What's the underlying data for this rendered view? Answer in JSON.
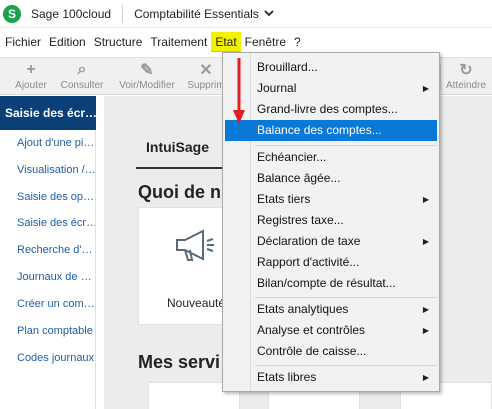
{
  "titlebar": {
    "app_name": "Sage 100cloud",
    "module": "Comptabilité Essentials",
    "logo_icon": "sage-logo-icon",
    "logo_glyph": "S"
  },
  "menubar": {
    "items": [
      "Fichier",
      "Edition",
      "Structure",
      "Traitement",
      "Etat",
      "Fenêtre",
      "?"
    ],
    "active": "Etat",
    "active_color": "#f2f200"
  },
  "toolbar": {
    "buttons": [
      {
        "label": "Ajouter",
        "icon": "plus-icon",
        "glyph": "+"
      },
      {
        "label": "Consulter",
        "icon": "search-icon",
        "glyph": "⌕"
      },
      {
        "label": "Voir/Modifier",
        "icon": "pencil-icon",
        "glyph": "✎"
      },
      {
        "label": "Supprim",
        "icon": "delete-icon",
        "glyph": "✕"
      },
      {
        "label": "Atteindre",
        "icon": "refresh-icon",
        "glyph": "↻"
      }
    ]
  },
  "sidebar": {
    "header": "Saisie des écr…",
    "items": [
      "Ajout d'une pi…",
      "Visualisation /…",
      "Saisie des op…",
      "Saisie des écr…",
      "Recherche d'…",
      "Journaux de …",
      "Créer un com…",
      "Plan comptable",
      "Codes journaux"
    ],
    "header_color": "#0a3f78",
    "link_color": "#1f5fa6"
  },
  "content": {
    "tab": "IntuiSage",
    "section1_title": "Quoi de n",
    "card1_label": "Nouveauté",
    "section2_title": "Mes servi",
    "megaphone_icon": "megaphone-icon"
  },
  "dropdown": {
    "group1": [
      {
        "label": "Brouillard...",
        "submenu": false
      },
      {
        "label": "Journal",
        "submenu": true
      },
      {
        "label": "Grand-livre des comptes...",
        "submenu": false
      },
      {
        "label": "Balance des comptes...",
        "submenu": false,
        "highlighted": true
      }
    ],
    "group2": [
      {
        "label": "Echéancier...",
        "submenu": false
      },
      {
        "label": "Balance âgée...",
        "submenu": false
      },
      {
        "label": "Etats tiers",
        "submenu": true
      },
      {
        "label": "Registres taxe...",
        "submenu": false
      },
      {
        "label": "Déclaration de taxe",
        "submenu": true
      },
      {
        "label": "Rapport d'activité...",
        "submenu": false
      },
      {
        "label": "Bilan/compte de résultat...",
        "submenu": false
      }
    ],
    "group3": [
      {
        "label": "Etats analytiques",
        "submenu": true
      },
      {
        "label": "Analyse et contrôles",
        "submenu": true
      },
      {
        "label": "Contrôle de caisse...",
        "submenu": false
      }
    ],
    "group4": [
      {
        "label": "Etats libres",
        "submenu": true
      }
    ],
    "highlight_color": "#0a78d7",
    "annotation_arrow_color": "#e02020"
  }
}
